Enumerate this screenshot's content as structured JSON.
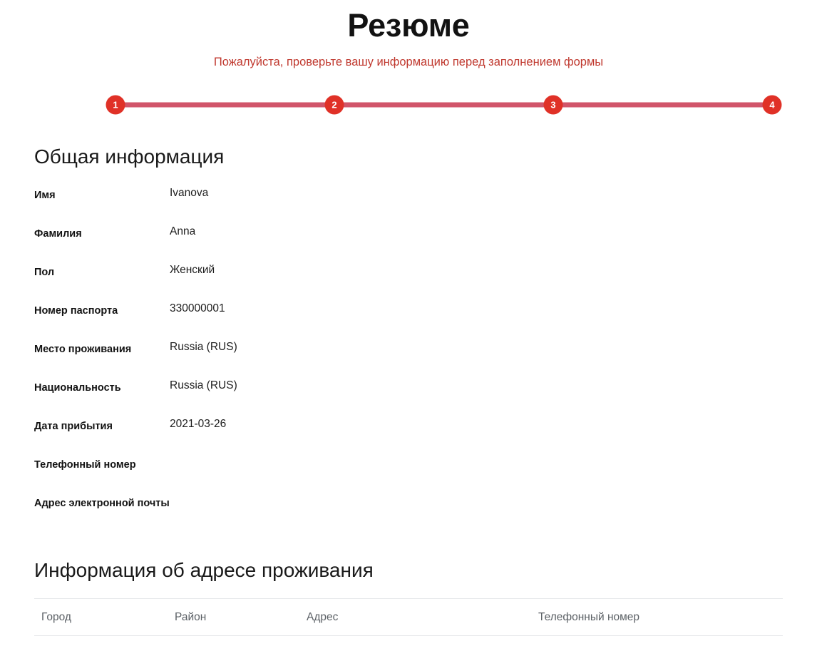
{
  "header": {
    "title": "Резюме",
    "subtitle": "Пожалуйста, проверьте вашу информацию перед заполнением формы"
  },
  "stepper": {
    "accent_color": "#e03127",
    "track_color": "#d1556a",
    "steps": [
      {
        "number": "1"
      },
      {
        "number": "2"
      },
      {
        "number": "3"
      },
      {
        "number": "4"
      }
    ]
  },
  "general_section": {
    "heading": "Общая информация",
    "fields": [
      {
        "label": "Имя",
        "value": "Ivanova"
      },
      {
        "label": "Фамилия",
        "value": "Anna"
      },
      {
        "label": "Пол",
        "value": "Женский"
      },
      {
        "label": "Номер паспорта",
        "value": "330000001"
      },
      {
        "label": "Место проживания",
        "value": "Russia (RUS)"
      },
      {
        "label": "Национальность",
        "value": "Russia (RUS)"
      },
      {
        "label": "Дата прибытия",
        "value": "2021-03-26"
      },
      {
        "label": "Телефонный номер",
        "value": ""
      },
      {
        "label": "Адрес электронной почты",
        "value": ""
      }
    ]
  },
  "address_section": {
    "heading": "Информация об адресе проживания",
    "table": {
      "columns": [
        "Город",
        "Район",
        "Адрес",
        "Телефонный номер"
      ],
      "rows": []
    }
  }
}
